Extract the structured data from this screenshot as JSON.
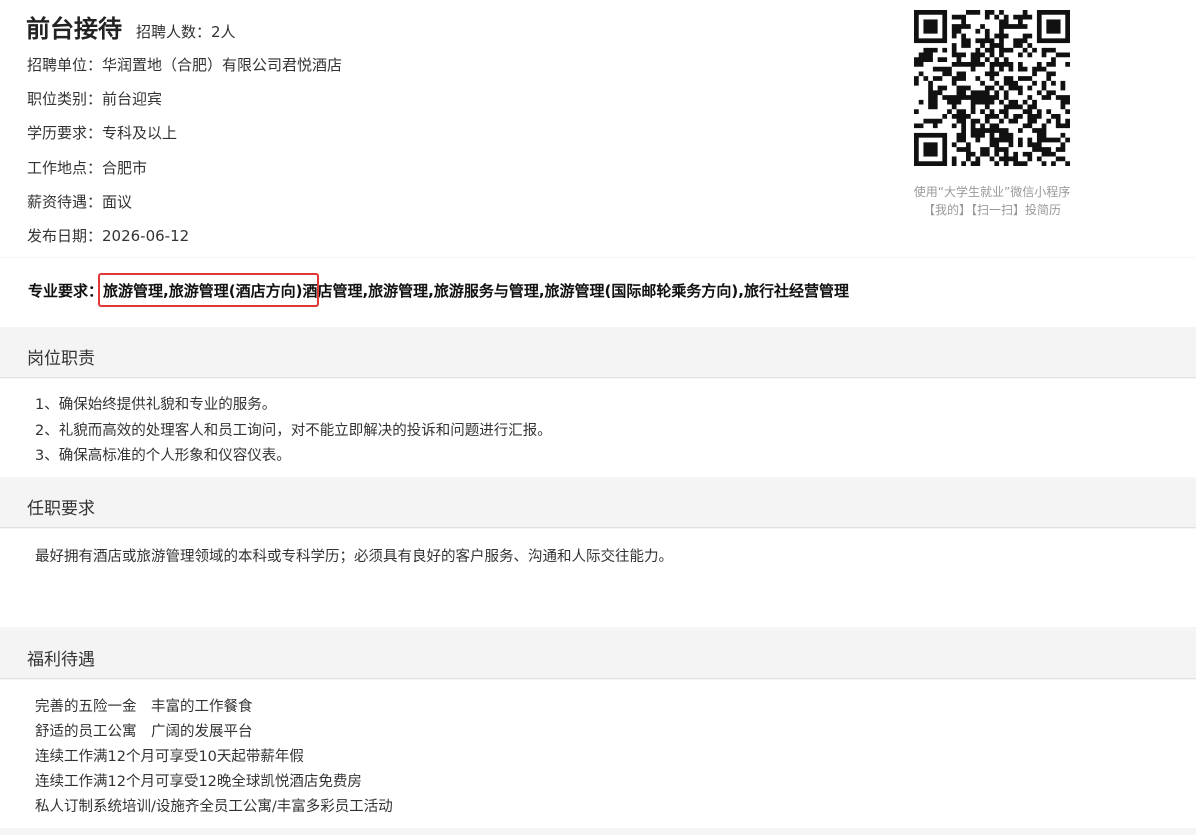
{
  "job": {
    "title": "前台接待",
    "headcount": "招聘人数：2人"
  },
  "info": [
    "招聘单位：华润置地（合肥）有限公司君悦酒店",
    "职位类别：前台迎宾",
    "学历要求：专科及以上",
    "工作地点：合肥市",
    "薪资待遇：面议",
    "发布日期：2026-06-12"
  ],
  "qr": {
    "icon": "qr-code-icon",
    "note_line1": "使用“大学生就业”微信小程序",
    "note_line2": "【我的】【扫一扫】投简历"
  },
  "major": {
    "label": "专业要求：",
    "highlighted": "旅游管理,旅游管理(酒店方向)",
    "rest": "酒店管理,旅游管理,旅游服务与管理,旅游管理(国际邮轮乘务方向),旅行社经营管理",
    "highlight_color": "#e03838"
  },
  "duties": {
    "heading": "岗位职责",
    "lines": [
      "1、确保始终提供礼貌和专业的服务。",
      "2、礼貌而高效的处理客人和员工询问，对不能立即解决的投诉和问题进行汇报。",
      "3、确保高标准的个人形象和仪容仪表。"
    ]
  },
  "requirements": {
    "heading": "任职要求",
    "lines": [
      "最好拥有酒店或旅游管理领域的本科或专科学历；必须具有良好的客户服务、沟通和人际交往能力。"
    ]
  },
  "benefits": {
    "heading": "福利待遇",
    "lines": [
      "完善的五险一金　丰富的工作餐食",
      "舒适的员工公寓　广阔的发展平台",
      "连续工作满12个月可享受10天起带薪年假",
      "连续工作满12个月可享受12晚全球凯悦酒店免费房",
      "私人订制系统培训/设施齐全员工公寓/丰富多彩员工活动"
    ]
  }
}
